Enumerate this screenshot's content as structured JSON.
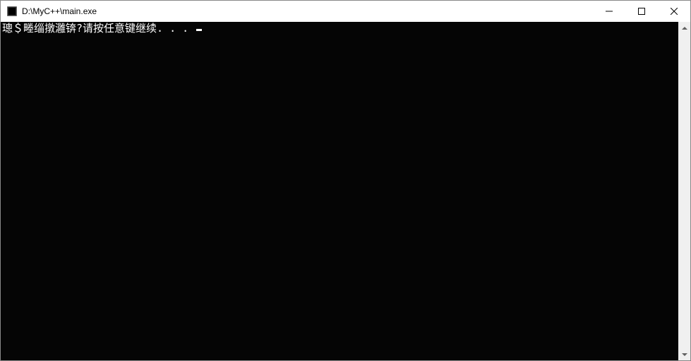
{
  "window": {
    "title": "D:\\MyC++\\main.exe"
  },
  "console": {
    "line1": "璁＄畻缁撴灉锛?请按任意键继续. . . "
  }
}
